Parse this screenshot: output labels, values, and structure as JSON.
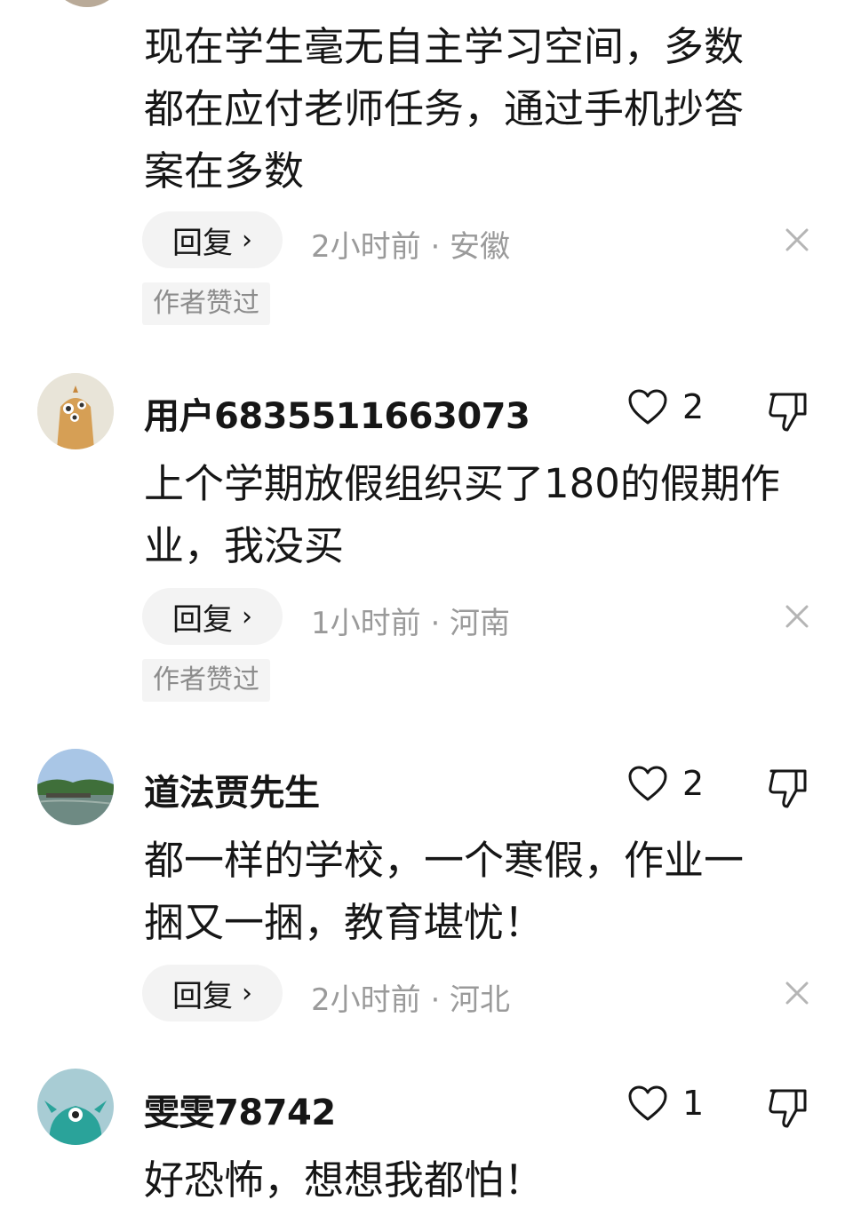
{
  "comments": [
    {
      "text_lines": [
        "现在学生毫无自主学习空间，多数",
        "都在应付老师任务，通过手机抄答",
        "案在多数"
      ],
      "reply_label": "回复",
      "meta": "2小时前 · 安徽",
      "badge": "作者赞过"
    },
    {
      "username": "用户6835511663073",
      "likes": "2",
      "text_lines": [
        "上个学期放假组织买了180的假期作",
        "业，我没买"
      ],
      "reply_label": "回复",
      "meta": "1小时前 · 河南",
      "badge": "作者赞过"
    },
    {
      "username": "道法贾先生",
      "likes": "2",
      "text_lines": [
        "都一样的学校，一个寒假，作业一",
        "捆又一捆，教育堪忧！"
      ],
      "reply_label": "回复",
      "meta": "2小时前 · 河北"
    },
    {
      "username": "雯雯78742",
      "likes": "1",
      "text_lines": [
        "好恐怖，想想我都怕！"
      ]
    }
  ],
  "icons": {
    "like": "heart-outline-icon",
    "dislike": "thumbs-down-outline-icon",
    "close": "close-icon",
    "reply_chevron": "chevron-right-icon"
  },
  "colors": {
    "text": "#161616",
    "meta": "#9a9a9a",
    "pill_bg": "#f3f3f3",
    "badge_bg": "#f4f4f4",
    "badge_text": "#8c8c8c"
  }
}
